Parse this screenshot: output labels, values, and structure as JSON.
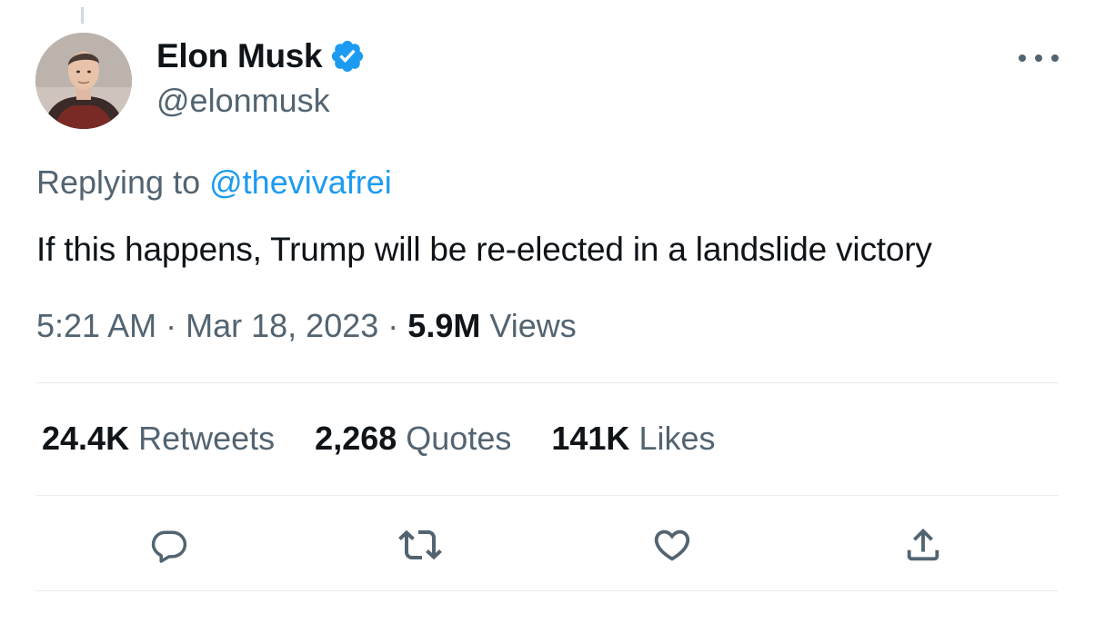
{
  "author": {
    "display_name": "Elon Musk",
    "handle": "@elonmusk",
    "verified": true,
    "verified_color": "#1d9bf0"
  },
  "reply": {
    "prefix": "Replying to",
    "mention": "@thevivafrei"
  },
  "tweet": {
    "text": "If this happens, Trump will be re-elected in a landslide victory"
  },
  "meta": {
    "time": "5:21 AM",
    "separator": "·",
    "date": "Mar 18, 2023",
    "views_count": "5.9M",
    "views_label": "Views"
  },
  "stats": {
    "retweets_count": "24.4K",
    "retweets_label": "Retweets",
    "quotes_count": "2,268",
    "quotes_label": "Quotes",
    "likes_count": "141K",
    "likes_label": "Likes"
  },
  "actions": {
    "reply_icon": "speech-bubble",
    "retweet_icon": "retweet-arrows",
    "like_icon": "heart",
    "share_icon": "share-upload"
  },
  "colors": {
    "text_primary": "#0f1419",
    "text_secondary": "#536471",
    "link": "#1d9bf0",
    "divider": "#e6ecf0"
  }
}
